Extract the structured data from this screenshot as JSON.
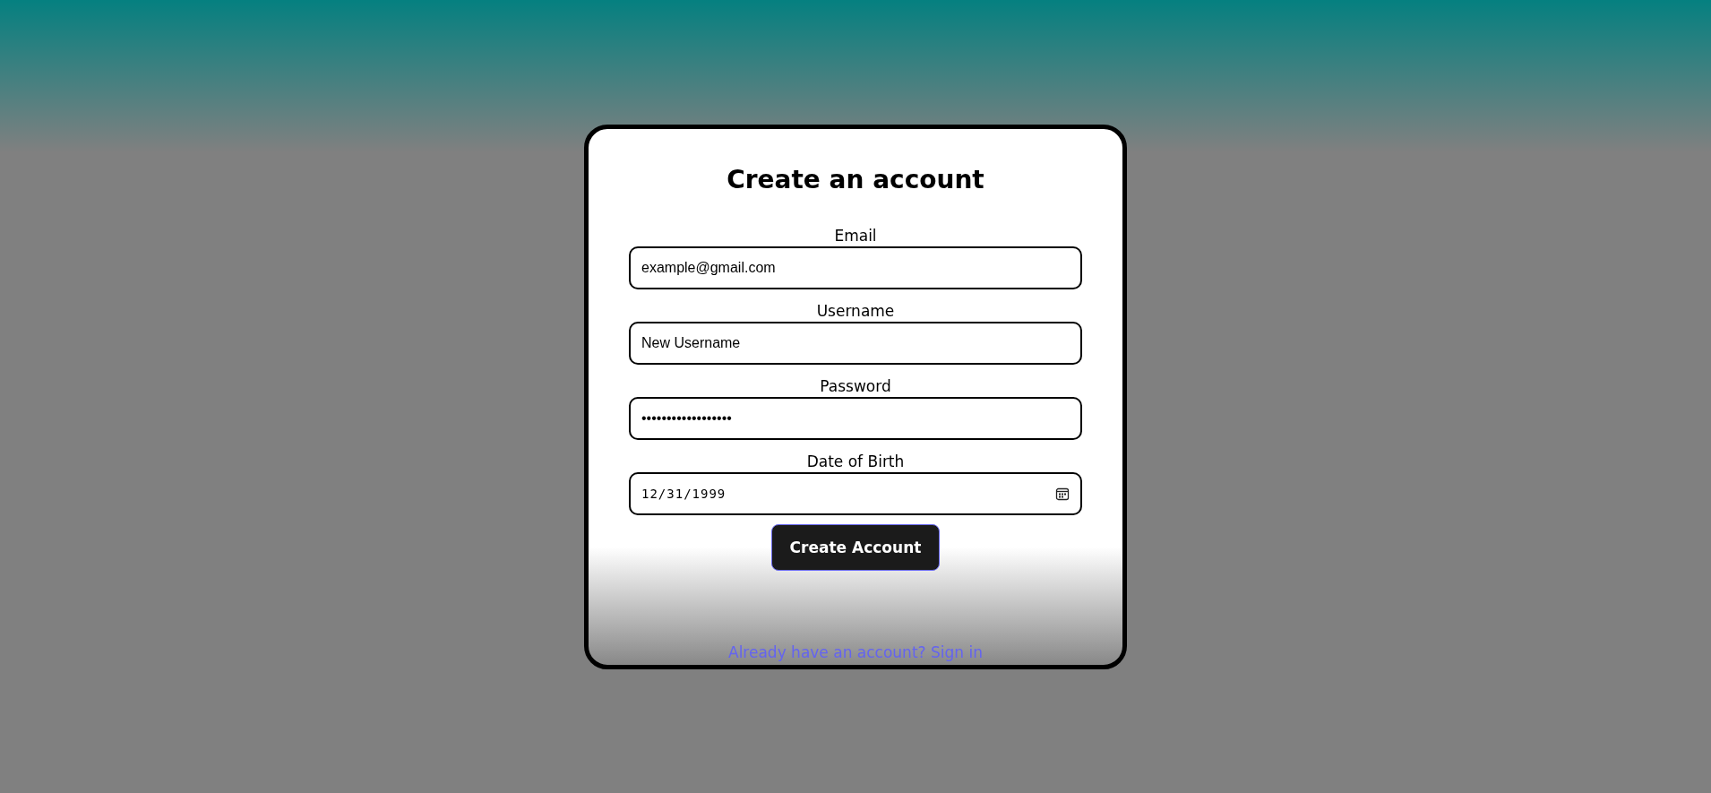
{
  "form": {
    "title": "Create an account",
    "fields": [
      {
        "kind": "text",
        "label": "Email",
        "value": "example@gmail.com"
      },
      {
        "kind": "text",
        "label": "Username",
        "value": "New Username"
      },
      {
        "kind": "text",
        "label": "Password",
        "value": "••••••••••••••••••"
      },
      {
        "kind": "date",
        "label": "Date of Birth",
        "value": "12/31/1999"
      }
    ],
    "submit": "Create Account",
    "link": "Already have an account? Sign in"
  }
}
